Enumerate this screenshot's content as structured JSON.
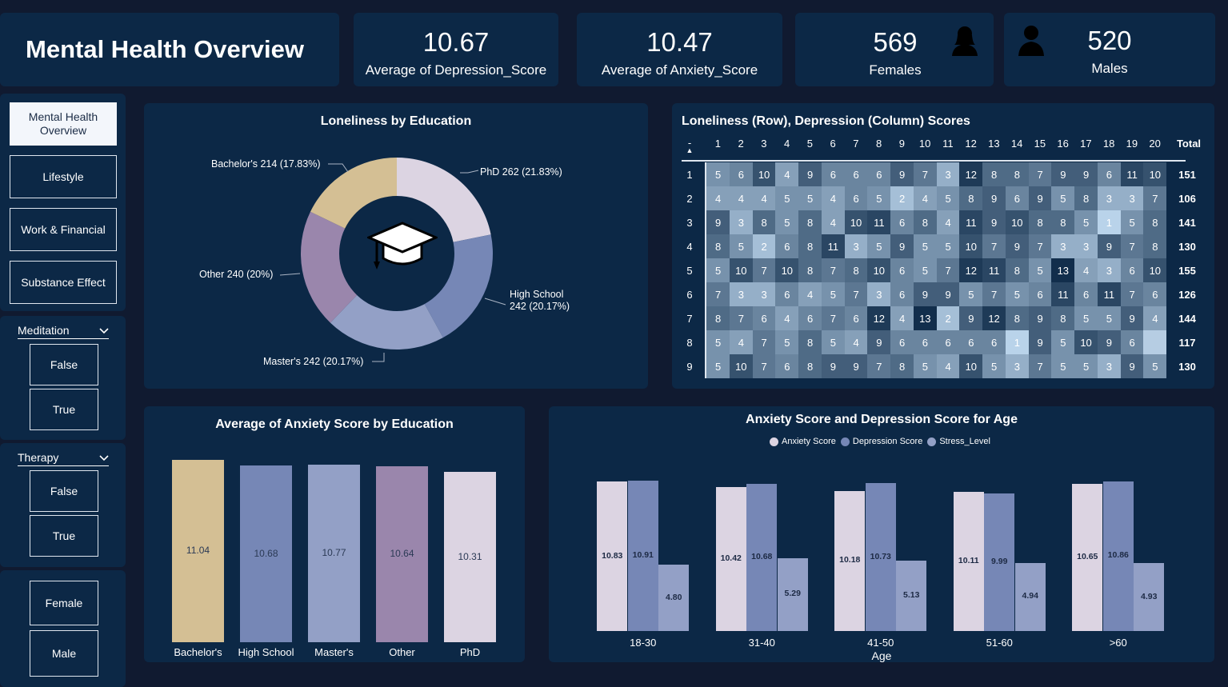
{
  "header": {
    "title": "Mental Health Overview",
    "kpis": [
      {
        "value": "10.67",
        "label": "Average of Depression_Score"
      },
      {
        "value": "10.47",
        "label": "Average of Anxiety_Score"
      },
      {
        "value": "569",
        "label": "Females"
      },
      {
        "value": "520",
        "label": "Males"
      }
    ]
  },
  "nav": {
    "items": [
      "Mental Health Overview",
      "Lifestyle",
      "Work & Financial",
      "Substance Effect"
    ],
    "active_index": 0
  },
  "slicers": {
    "meditation": {
      "label": "Meditation",
      "options": [
        "False",
        "True"
      ]
    },
    "therapy": {
      "label": "Therapy",
      "options": [
        "False",
        "True"
      ]
    },
    "gender": {
      "options": [
        "Female",
        "Male"
      ]
    }
  },
  "colors": {
    "bachelors": "#d4bf94",
    "high_school": "#7687b6",
    "masters": "#93a0c6",
    "other": "#9a86ac",
    "phd": "#dcd4e2",
    "anxiety": "#dcd4e2",
    "depression": "#7687b6",
    "stress": "#93a0c6"
  },
  "chart_data": [
    {
      "type": "pie",
      "title": "Loneliness by Education",
      "center_icon": "graduation-cap-icon",
      "slices": [
        {
          "name": "PhD",
          "value": 262,
          "percent": "21.83%",
          "label": "PhD 262 (21.83%)"
        },
        {
          "name": "High School",
          "value": 242,
          "percent": "20.17%",
          "label_line1": "High School",
          "label_line2": "242 (20.17%)"
        },
        {
          "name": "Master's",
          "value": 242,
          "percent": "20.17%",
          "label": "Master's 242 (20.17%)"
        },
        {
          "name": "Other",
          "value": 240,
          "percent": "20%",
          "label": "Other 240 (20%)"
        },
        {
          "name": "Bachelor's",
          "value": 214,
          "percent": "17.83%",
          "label": "Bachelor's 214 (17.83%)"
        }
      ]
    },
    {
      "type": "heatmap",
      "title": "Loneliness (Row), Depression (Column) Scores",
      "corner": "-",
      "columns": [
        "1",
        "2",
        "3",
        "4",
        "5",
        "6",
        "7",
        "8",
        "9",
        "10",
        "11",
        "12",
        "13",
        "14",
        "15",
        "16",
        "17",
        "18",
        "19",
        "20"
      ],
      "total_label": "Total",
      "rows": [
        {
          "label": "1",
          "values": [
            5,
            6,
            10,
            4,
            9,
            6,
            6,
            6,
            9,
            7,
            3,
            12,
            8,
            8,
            7,
            9,
            9,
            6,
            11,
            10
          ],
          "total": 151
        },
        {
          "label": "2",
          "values": [
            4,
            4,
            4,
            5,
            5,
            4,
            6,
            5,
            2,
            4,
            5,
            8,
            9,
            6,
            9,
            5,
            8,
            3,
            3,
            7
          ],
          "total": 106
        },
        {
          "label": "3",
          "values": [
            9,
            3,
            8,
            5,
            8,
            4,
            10,
            11,
            6,
            8,
            4,
            11,
            9,
            10,
            8,
            8,
            5,
            1,
            5,
            8
          ],
          "total": 141
        },
        {
          "label": "4",
          "values": [
            8,
            5,
            2,
            6,
            8,
            11,
            3,
            5,
            9,
            5,
            5,
            10,
            7,
            9,
            7,
            3,
            3,
            9,
            7,
            8
          ],
          "total": 130
        },
        {
          "label": "5",
          "values": [
            5,
            10,
            7,
            10,
            8,
            7,
            8,
            10,
            6,
            5,
            7,
            12,
            11,
            8,
            5,
            13,
            4,
            3,
            6,
            10
          ],
          "total": 155
        },
        {
          "label": "6",
          "values": [
            7,
            3,
            3,
            6,
            4,
            5,
            7,
            3,
            6,
            9,
            9,
            5,
            7,
            5,
            6,
            11,
            6,
            11,
            7,
            6
          ],
          "total": 126
        },
        {
          "label": "7",
          "values": [
            8,
            7,
            6,
            4,
            6,
            7,
            6,
            12,
            4,
            13,
            2,
            9,
            12,
            8,
            9,
            8,
            5,
            5,
            9,
            4
          ],
          "total": 144
        },
        {
          "label": "8",
          "values": [
            5,
            4,
            7,
            5,
            8,
            5,
            4,
            9,
            6,
            6,
            6,
            6,
            6,
            1,
            9,
            5,
            10,
            9,
            6,
            null
          ],
          "total": 117
        },
        {
          "label": "9",
          "values": [
            5,
            10,
            7,
            6,
            8,
            9,
            9,
            7,
            8,
            5,
            4,
            10,
            5,
            3,
            7,
            5,
            5,
            3,
            9,
            5
          ],
          "total": 130
        }
      ]
    },
    {
      "type": "bar",
      "title": "Average of Anxiety Score by Education",
      "categories": [
        "Bachelor's",
        "High School",
        "Master's",
        "Other",
        "PhD"
      ],
      "values": [
        11.04,
        10.68,
        10.77,
        10.64,
        10.31
      ],
      "value_labels": [
        "11.04",
        "10.68",
        "10.77",
        "10.64",
        "10.31"
      ]
    },
    {
      "type": "bar",
      "title": "Anxiety Score and Depression Score for Age",
      "xlabel": "Age",
      "categories": [
        "18-30",
        "31-40",
        "41-50",
        "51-60",
        ">60"
      ],
      "series": [
        {
          "name": "Anxiety Score",
          "values": [
            10.83,
            10.42,
            10.18,
            10.11,
            10.65
          ],
          "labels": [
            "10.83",
            "10.42",
            "10.18",
            "10.11",
            "10.65"
          ]
        },
        {
          "name": "Depression Score",
          "values": [
            10.91,
            10.68,
            10.73,
            9.99,
            10.86
          ],
          "labels": [
            "10.91",
            "10.68",
            "10.73",
            "9.99",
            "10.86"
          ]
        },
        {
          "name": "Stress_Level",
          "values": [
            4.8,
            5.29,
            5.13,
            4.94,
            4.93
          ],
          "labels": [
            "4.80",
            "5.29",
            "5.13",
            "4.94",
            "4.93"
          ]
        }
      ]
    }
  ]
}
